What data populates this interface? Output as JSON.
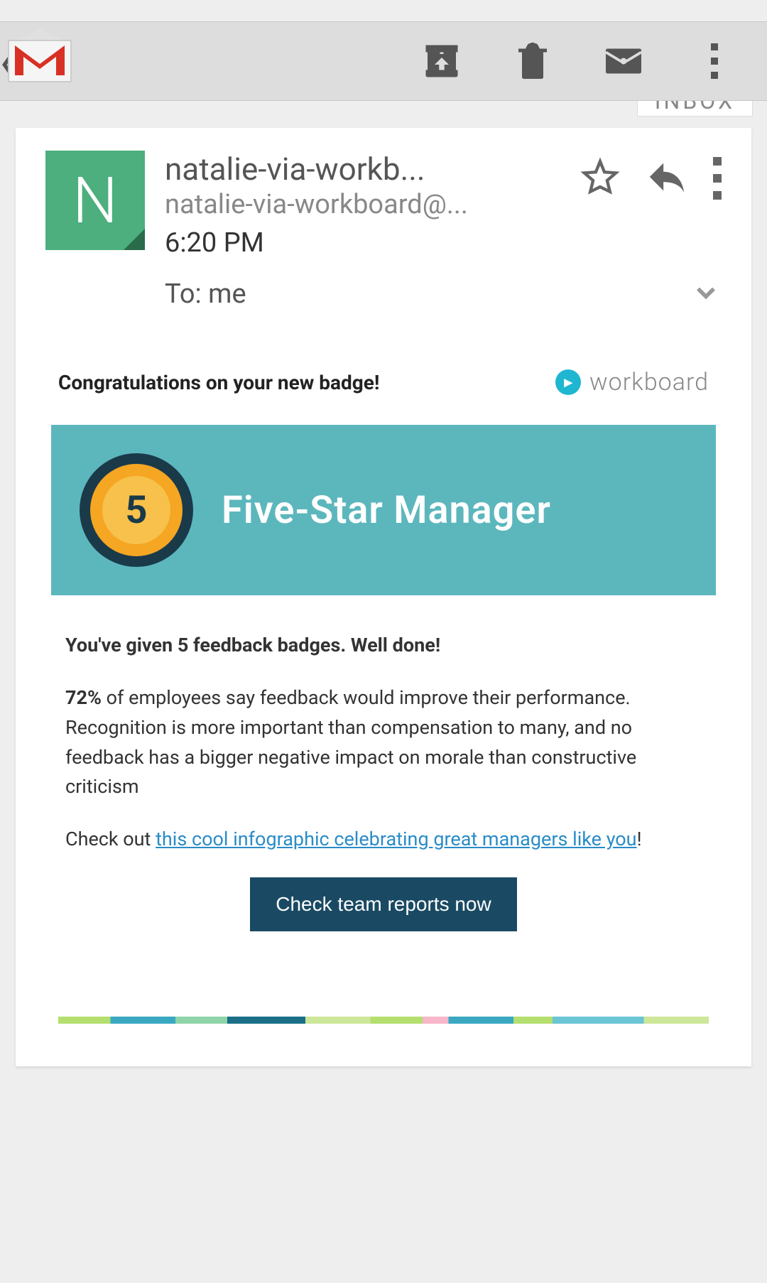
{
  "topbar": {
    "folder_label": "INBOX"
  },
  "email": {
    "avatar_letter": "N",
    "sender_name": "natalie-via-workb...",
    "sender_email": "natalie-via-workboard@...",
    "time": "6:20 PM",
    "to_label": "To: me"
  },
  "message": {
    "congrats": "Congratulations on your new badge!",
    "brand": "workboard",
    "banner_title": "Five-Star Manager",
    "badge_number": "5",
    "line1": "You've given 5 feedback badges. Well done!",
    "stat_prefix": "72%",
    "line2_rest": " of employees say feedback would improve their performance. Recognition is more important than compensation to many, and no feedback has a bigger negative impact on morale than constructive criticism",
    "checkout_prefix": "Check out ",
    "checkout_link": "this cool infographic celebrating great managers like you",
    "checkout_suffix": "!",
    "cta": "Check team reports now"
  }
}
